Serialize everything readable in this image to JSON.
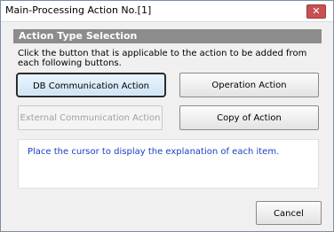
{
  "window": {
    "title": "Main-Processing Action No.[1]",
    "close_glyph": "✕"
  },
  "section": {
    "header": "Action Type Selection",
    "instruction": "Click the button that is applicable to the action to be added from each following buttons."
  },
  "buttons": {
    "db_communication": "DB Communication Action",
    "operation": "Operation Action",
    "external_communication": "External Communication Action",
    "copy": "Copy of Action",
    "cancel": "Cancel"
  },
  "explanation": {
    "text": "Place the cursor to display the explanation of each item."
  },
  "colors": {
    "section_header_bg": "#8c8c8c",
    "explanation_text": "#1b3fc4",
    "close_button_bg": "#c75050"
  }
}
